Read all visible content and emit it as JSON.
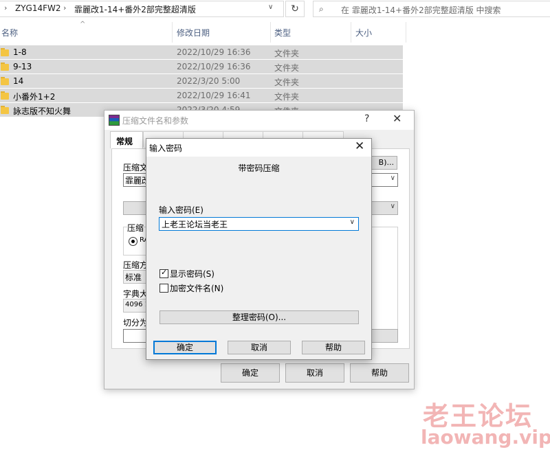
{
  "explorer": {
    "breadcrumbs": [
      "ZYG14FW2",
      "霏麗改1-14+番外2部完整超清版"
    ],
    "search_placeholder": "在 霏麗改1-14+番外2部完整超清版 中搜索",
    "columns": {
      "name": "名称",
      "date": "修改日期",
      "type": "类型",
      "size": "大小"
    },
    "files": [
      {
        "name": "1-8",
        "date": "2022/10/29 16:36",
        "type": "文件夹"
      },
      {
        "name": "9-13",
        "date": "2022/10/29 16:36",
        "type": "文件夹"
      },
      {
        "name": "14",
        "date": "2022/3/20 5:00",
        "type": "文件夹"
      },
      {
        "name": "小番外1+2",
        "date": "2022/10/29 16:41",
        "type": "文件夹"
      },
      {
        "name": "詠志版不知火舞",
        "date": "2022/3/20 4:59",
        "type": "文件夹"
      }
    ]
  },
  "archive_dialog": {
    "title": "压缩文件名和参数",
    "help": "?",
    "tab_general": "常规",
    "archive_name_label": "压缩文",
    "archive_name_value": "霏麗改",
    "browse_label": "B)...",
    "format_group": "压缩",
    "format_radio": "RA",
    "method_label": "压缩方",
    "method_value": "标准",
    "dict_label": "字典大",
    "dict_value": "4096 1",
    "split_label": "切分为",
    "ok": "确定",
    "cancel": "取消",
    "help_btn": "帮助"
  },
  "password_dialog": {
    "title": "输入密码",
    "subtitle": "带密码压缩",
    "password_label": "输入密码(E)",
    "password_value": "上老王论坛当老王",
    "show_password": "显示密码(S)",
    "show_password_checked": true,
    "encrypt_names": "加密文件名(N)",
    "encrypt_names_checked": false,
    "organize_btn": "整理密码(O)...",
    "ok": "确定",
    "cancel": "取消",
    "help": "帮助"
  },
  "watermark": {
    "cn": "老王论坛",
    "url": "laowang.vip"
  }
}
